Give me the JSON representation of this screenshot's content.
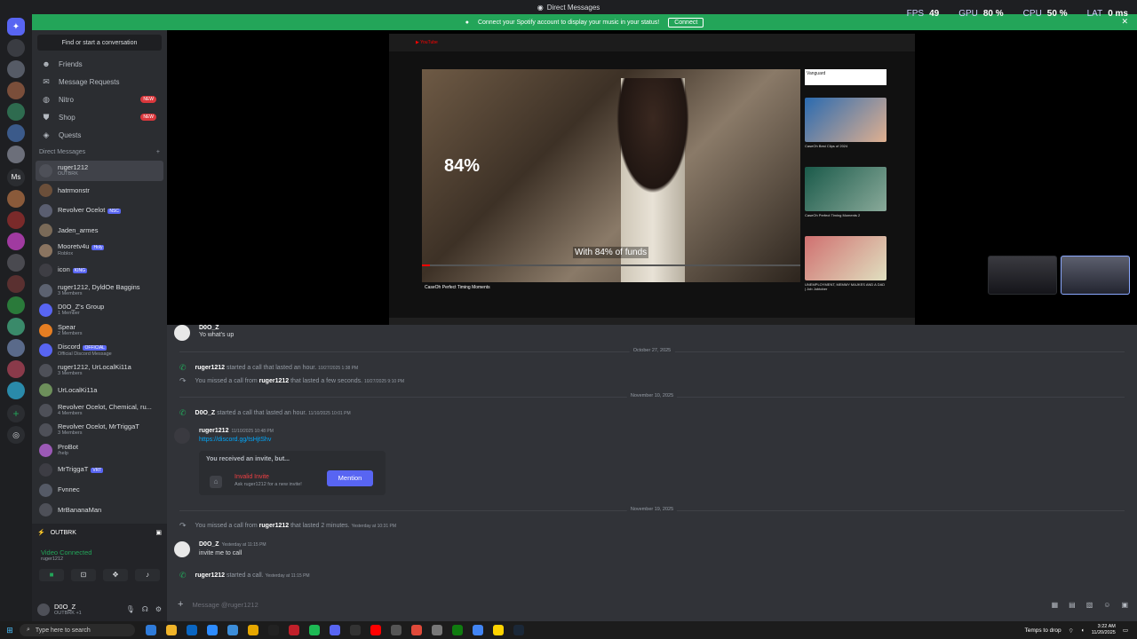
{
  "window": {
    "title": "Direct Messages"
  },
  "overlay": {
    "fps_label": "FPS",
    "fps": "49",
    "gpu_label": "GPU",
    "gpu": "80 %",
    "cpu_label": "CPU",
    "cpu": "50 %",
    "lat_label": "LAT",
    "lat": "0 ms"
  },
  "banner": {
    "text": "Connect your Spotify account to display your music in your status!",
    "button": "Connect"
  },
  "sidebar": {
    "search": "Find or start a conversation",
    "nav": [
      {
        "label": "Friends",
        "icon": "friends-icon"
      },
      {
        "label": "Message Requests",
        "icon": "mail-icon"
      },
      {
        "label": "Nitro",
        "icon": "nitro-icon",
        "badge": "NEW"
      },
      {
        "label": "Shop",
        "icon": "shop-icon",
        "badge": "NEW"
      },
      {
        "label": "Quests",
        "icon": "quests-icon"
      }
    ],
    "dm_header": "Direct Messages",
    "dm_add": "+",
    "dms": [
      {
        "name": "ruger1212",
        "sub": "OUTBRK",
        "color": "#4e5058"
      },
      {
        "name": "hatrmonstr",
        "sub": "",
        "color": "#6b4f3a"
      },
      {
        "name": "Revolver Ocelot",
        "tag": "NSC",
        "sub": "",
        "color": "#5a5e70"
      },
      {
        "name": "Jaden_armes",
        "sub": "",
        "color": "#7a6a58"
      },
      {
        "name": "Mooretv4u",
        "tag": "Holy",
        "sub": "Roblox",
        "color": "#8a7460"
      },
      {
        "name": "icon",
        "tag": "KING",
        "sub": "",
        "color": "#3e3e44"
      },
      {
        "name": "ruger1212, DyldOe Baggins",
        "sub": "3 Members",
        "color": "#5c6270"
      },
      {
        "name": "D0O_Z's Group",
        "sub": "1 Member",
        "color": "#5865f2"
      },
      {
        "name": "Spear",
        "sub": "2 Members",
        "color": "#e67e22"
      },
      {
        "name": "Discord",
        "tag": "OFFICIAL",
        "sub": "Official Discord Message",
        "color": "#5865f2"
      },
      {
        "name": "ruger1212, UrLocalKi11a",
        "sub": "3 Members",
        "color": "#4e5058"
      },
      {
        "name": "UrLocalKi11a",
        "sub": "",
        "color": "#6d8f5b"
      },
      {
        "name": "Revolver Ocelot, Chemical, ru...",
        "sub": "4 Members",
        "color": "#4e5058"
      },
      {
        "name": "Revolver Ocelot, MrTriggaT",
        "sub": "3 Members",
        "color": "#4e5058"
      },
      {
        "name": "ProBot",
        "sub": "/help",
        "color": "#9b59b6"
      },
      {
        "name": "MrTriggaT",
        "tag": "VRT",
        "sub": "",
        "color": "#3d3d44"
      },
      {
        "name": "Fvnnec",
        "sub": "",
        "color": "#555a66"
      },
      {
        "name": "MrBananaMan",
        "sub": "",
        "color": "#4e5058"
      }
    ],
    "voice": {
      "server": "OUTBRK",
      "status": "Video Connected",
      "channel": "ruger1212"
    },
    "user": {
      "name": "D0O_Z",
      "sub": "OUTBRK +1"
    }
  },
  "stream": {
    "percent_overlay": "84%",
    "caption": "With 84% of funds",
    "video_title": "CaseOh Perfect Timing Moments",
    "progress": 0.02,
    "side_videos": [
      {
        "title": "CaseOh Best Clips of 2024"
      },
      {
        "title": "CaseOh Perfect Timing Moments 2"
      },
      {
        "title": "UNEMPLOYMENT, MEMMY MAJKES AND A DAD | Job Jobtober"
      }
    ],
    "ad_brand": "Vanguard"
  },
  "chat": {
    "top_msg": {
      "author": "D0O_Z",
      "text": "Yo what's up"
    },
    "dates": [
      "October 27, 2025",
      "November 10, 2025",
      "November 19, 2025"
    ],
    "events": [
      {
        "who": "ruger1212",
        "pre": "",
        "text": "started a call that lasted an hour.",
        "ts": "10/27/2025 1:38 PM",
        "kind": "call"
      },
      {
        "who": "ruger1212",
        "pre": "You missed a call from",
        "text": "that lasted a few seconds.",
        "ts": "10/27/2025 9:10 PM",
        "kind": "missed"
      },
      {
        "who": "D0O_Z",
        "pre": "",
        "text": "started a call that lasted an hour.",
        "ts": "11/10/2025 10:01 PM",
        "kind": "call"
      },
      {
        "who": "ruger1212",
        "pre": "You missed a call from",
        "text": "that lasted 2 minutes.",
        "ts": "Yesterday at 10:31 PM",
        "kind": "missed"
      },
      {
        "who": "ruger1212",
        "pre": "",
        "text": "started a call.",
        "ts": "Yesterday at 11:15 PM",
        "kind": "call"
      }
    ],
    "link_msg": {
      "author": "ruger1212",
      "ts": "11/10/2025 10:48 PM",
      "link": "https://discord.gg/tsHjtShv"
    },
    "invite": {
      "header": "You received an invite, but...",
      "title": "Invalid Invite",
      "sub": "Ask ruger1212 for a new invite!",
      "button": "Mention"
    },
    "reply_msg": {
      "author": "D0O_Z",
      "ts": "Yesterday at 11:15 PM",
      "text": "invite me to call"
    },
    "composer_placeholder": "Message @ruger1212"
  },
  "taskbar": {
    "search": "Type here to search",
    "tray_text": "Temps to drop",
    "time": "3:22 AM",
    "date": "11/20/2025"
  },
  "colors": {
    "green": "#23a559",
    "blurple": "#5865f2",
    "red": "#f23f43"
  }
}
